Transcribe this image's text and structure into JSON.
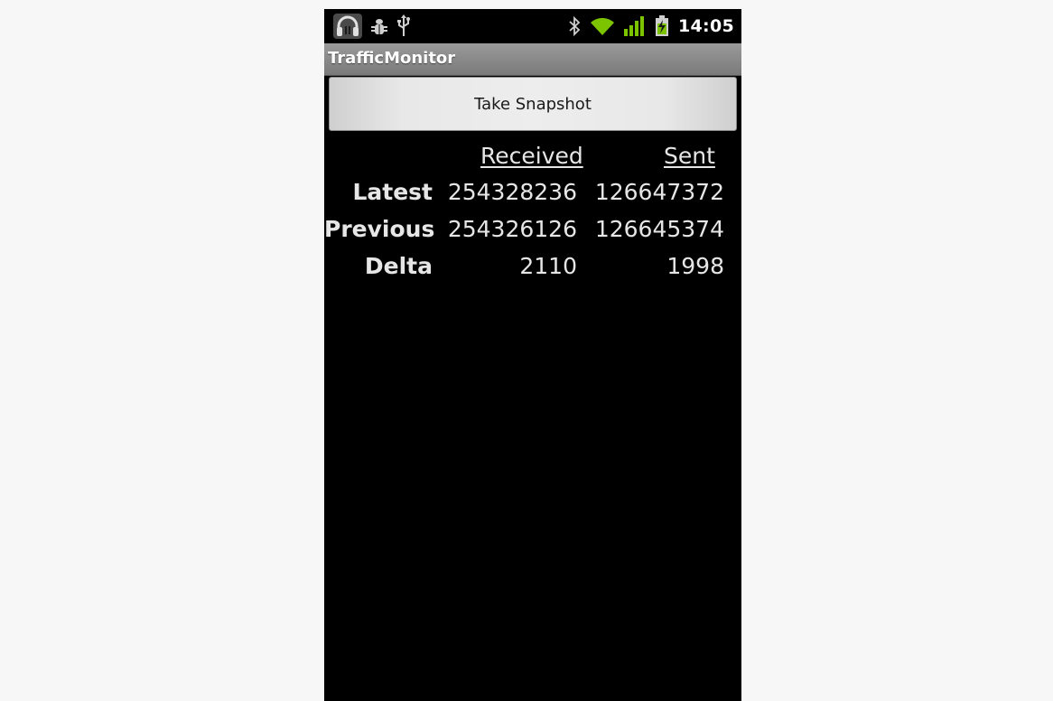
{
  "status_bar": {
    "left_icons": [
      "headphones-icon",
      "debug-icon",
      "usb-icon"
    ],
    "right_icons": [
      "bluetooth-icon",
      "wifi-icon",
      "signal-icon",
      "battery-charging-icon"
    ],
    "time": "14:05"
  },
  "app": {
    "title": "TrafficMonitor"
  },
  "button": {
    "label": "Take Snapshot"
  },
  "table": {
    "headers": [
      "Received",
      "Sent"
    ],
    "rows": [
      {
        "label": "Latest",
        "received": "254328236",
        "sent": "126647372"
      },
      {
        "label": "Previous",
        "received": "254326126",
        "sent": "126645374"
      },
      {
        "label": "Delta",
        "received": "2110",
        "sent": "1998"
      }
    ]
  },
  "colors": {
    "screen_bg": "#000000",
    "page_bg": "#f7f7f7",
    "titlebar": "#8a8a8a",
    "accent_green": "#7cc400"
  }
}
